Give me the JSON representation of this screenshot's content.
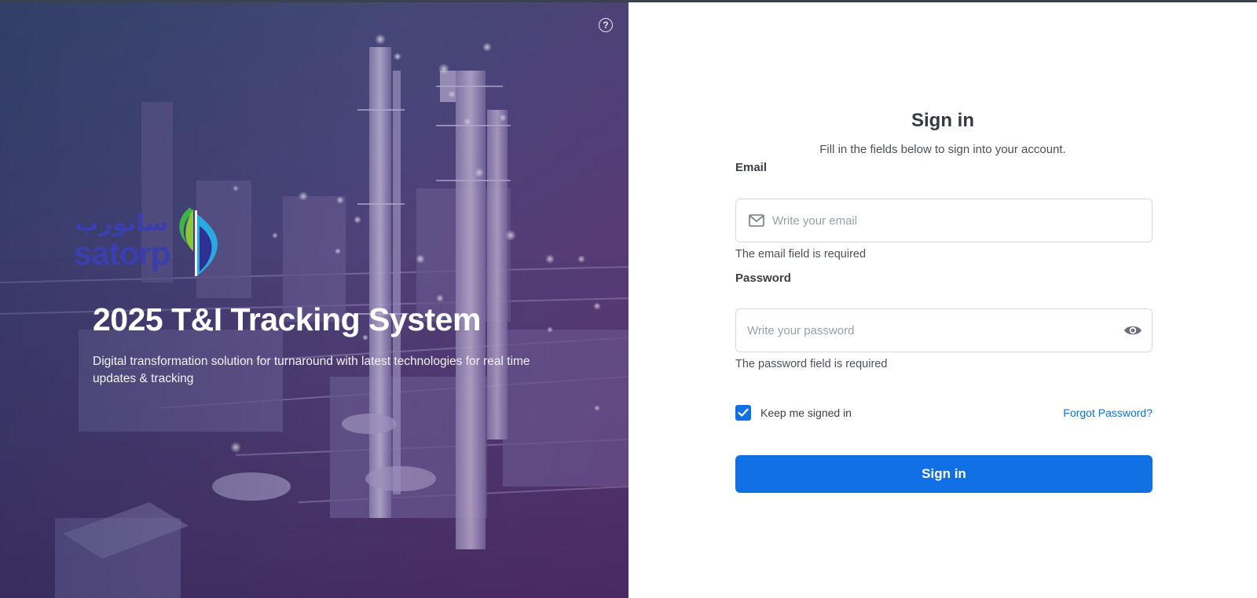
{
  "hero": {
    "logo_arabic": "ساتورب",
    "logo_latin": "satorp",
    "title": "2025 T&I Tracking System",
    "description": "Digital transformation solution for turnaround with latest technologies for real time updates & tracking"
  },
  "help": {
    "symbol": "?"
  },
  "form": {
    "title": "Sign in",
    "subtitle": "Fill in the fields below to sign into your account.",
    "email": {
      "label": "Email",
      "placeholder": "Write your email",
      "value": "",
      "error": "The email field is required"
    },
    "password": {
      "label": "Password",
      "placeholder": "Write your password",
      "value": "",
      "error": "The password field is required"
    },
    "remember": {
      "label": "Keep me signed in",
      "checked": true
    },
    "forgot_label": "Forgot Password?",
    "submit_label": "Sign in"
  },
  "colors": {
    "accent": "#1170e4",
    "logo_blue": "#3a3fb0",
    "logo_green": "#3db54a",
    "logo_cyan": "#29a9e0"
  },
  "icons": {
    "help": "help-circle-icon",
    "email": "mail-icon",
    "password_toggle": "eye-icon",
    "checkbox": "check-icon"
  }
}
